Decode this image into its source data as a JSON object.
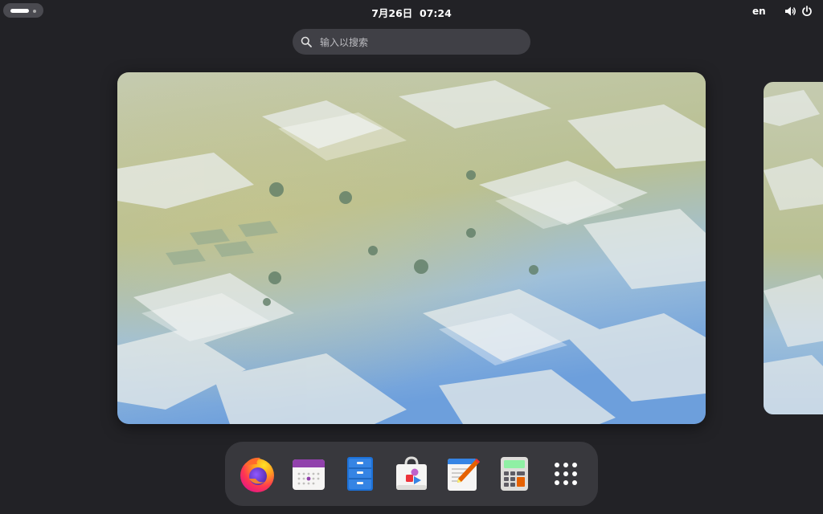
{
  "topbar": {
    "clock_date": "7月26日",
    "clock_time": "07:24",
    "language": "en",
    "icons": [
      "volume-icon",
      "power-icon"
    ]
  },
  "search": {
    "placeholder": "输入以搜索"
  },
  "workspaces": {
    "current_wallpaper": "isometric-city-wallpaper",
    "next_wallpaper": "isometric-city-wallpaper"
  },
  "dock": {
    "apps": [
      "firefox-icon",
      "calendar-icon",
      "files-icon",
      "software-store-icon",
      "text-editor-icon",
      "calculator-icon",
      "app-grid-icon"
    ]
  },
  "colors": {
    "background": "#222226",
    "panel": "#38383d",
    "search_bg": "#404046"
  }
}
